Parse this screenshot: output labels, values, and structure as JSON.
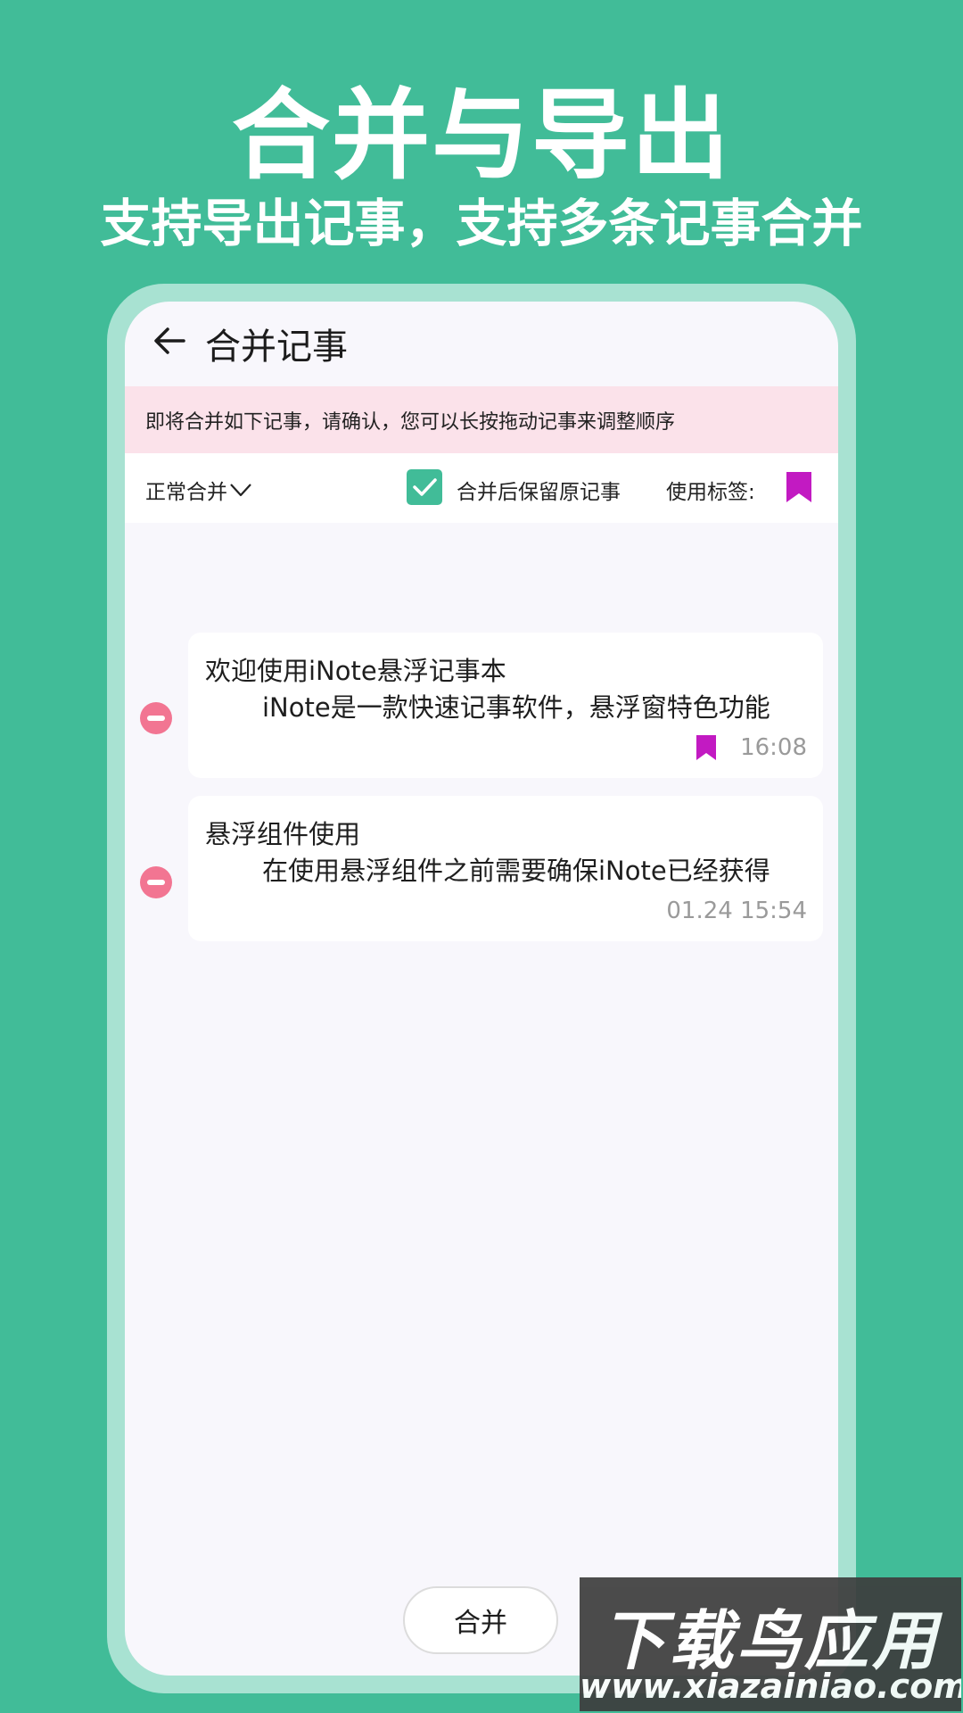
{
  "colors": {
    "background": "#41bc98",
    "accent": "#41bc98",
    "banner_bg": "#fbe2ea",
    "remove": "#f27592",
    "tag": "#c21ac2"
  },
  "promo": {
    "headline": "合并与导出",
    "subheadline": "支持导出记事，支持多条记事合并"
  },
  "header": {
    "back_icon": "arrow-left-icon",
    "title": "合并记事"
  },
  "banner": {
    "text": "即将合并如下记事，请确认，您可以长按拖动记事来调整顺序"
  },
  "options": {
    "merge_mode": "正常合并",
    "keep_original_checked": true,
    "keep_original_label": "合并后保留原记事",
    "tag_label": "使用标签:",
    "tag_icon": "bookmark-icon"
  },
  "notes": [
    {
      "title": "欢迎使用iNote悬浮记事本",
      "preview": "iNote是一款快速记事软件，悬浮窗特色功能",
      "has_tag": true,
      "time": "16:08"
    },
    {
      "title": "悬浮组件使用",
      "preview": "在使用悬浮组件之前需要确保iNote已经获得",
      "has_tag": false,
      "time": "01.24 15:54"
    }
  ],
  "footer": {
    "merge_button": "合并"
  },
  "watermark": {
    "title": "下载鸟应用",
    "url": "www.xiazainiao.com"
  }
}
